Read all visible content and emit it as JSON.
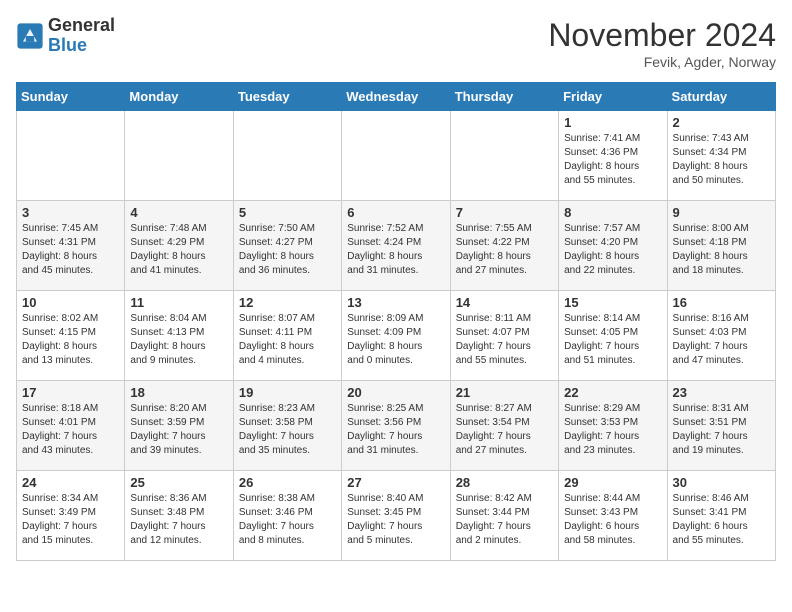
{
  "logo": {
    "general": "General",
    "blue": "Blue"
  },
  "title": "November 2024",
  "subtitle": "Fevik, Agder, Norway",
  "weekdays": [
    "Sunday",
    "Monday",
    "Tuesday",
    "Wednesday",
    "Thursday",
    "Friday",
    "Saturday"
  ],
  "weeks": [
    [
      {
        "day": "",
        "info": ""
      },
      {
        "day": "",
        "info": ""
      },
      {
        "day": "",
        "info": ""
      },
      {
        "day": "",
        "info": ""
      },
      {
        "day": "",
        "info": ""
      },
      {
        "day": "1",
        "info": "Sunrise: 7:41 AM\nSunset: 4:36 PM\nDaylight: 8 hours\nand 55 minutes."
      },
      {
        "day": "2",
        "info": "Sunrise: 7:43 AM\nSunset: 4:34 PM\nDaylight: 8 hours\nand 50 minutes."
      }
    ],
    [
      {
        "day": "3",
        "info": "Sunrise: 7:45 AM\nSunset: 4:31 PM\nDaylight: 8 hours\nand 45 minutes."
      },
      {
        "day": "4",
        "info": "Sunrise: 7:48 AM\nSunset: 4:29 PM\nDaylight: 8 hours\nand 41 minutes."
      },
      {
        "day": "5",
        "info": "Sunrise: 7:50 AM\nSunset: 4:27 PM\nDaylight: 8 hours\nand 36 minutes."
      },
      {
        "day": "6",
        "info": "Sunrise: 7:52 AM\nSunset: 4:24 PM\nDaylight: 8 hours\nand 31 minutes."
      },
      {
        "day": "7",
        "info": "Sunrise: 7:55 AM\nSunset: 4:22 PM\nDaylight: 8 hours\nand 27 minutes."
      },
      {
        "day": "8",
        "info": "Sunrise: 7:57 AM\nSunset: 4:20 PM\nDaylight: 8 hours\nand 22 minutes."
      },
      {
        "day": "9",
        "info": "Sunrise: 8:00 AM\nSunset: 4:18 PM\nDaylight: 8 hours\nand 18 minutes."
      }
    ],
    [
      {
        "day": "10",
        "info": "Sunrise: 8:02 AM\nSunset: 4:15 PM\nDaylight: 8 hours\nand 13 minutes."
      },
      {
        "day": "11",
        "info": "Sunrise: 8:04 AM\nSunset: 4:13 PM\nDaylight: 8 hours\nand 9 minutes."
      },
      {
        "day": "12",
        "info": "Sunrise: 8:07 AM\nSunset: 4:11 PM\nDaylight: 8 hours\nand 4 minutes."
      },
      {
        "day": "13",
        "info": "Sunrise: 8:09 AM\nSunset: 4:09 PM\nDaylight: 8 hours\nand 0 minutes."
      },
      {
        "day": "14",
        "info": "Sunrise: 8:11 AM\nSunset: 4:07 PM\nDaylight: 7 hours\nand 55 minutes."
      },
      {
        "day": "15",
        "info": "Sunrise: 8:14 AM\nSunset: 4:05 PM\nDaylight: 7 hours\nand 51 minutes."
      },
      {
        "day": "16",
        "info": "Sunrise: 8:16 AM\nSunset: 4:03 PM\nDaylight: 7 hours\nand 47 minutes."
      }
    ],
    [
      {
        "day": "17",
        "info": "Sunrise: 8:18 AM\nSunset: 4:01 PM\nDaylight: 7 hours\nand 43 minutes."
      },
      {
        "day": "18",
        "info": "Sunrise: 8:20 AM\nSunset: 3:59 PM\nDaylight: 7 hours\nand 39 minutes."
      },
      {
        "day": "19",
        "info": "Sunrise: 8:23 AM\nSunset: 3:58 PM\nDaylight: 7 hours\nand 35 minutes."
      },
      {
        "day": "20",
        "info": "Sunrise: 8:25 AM\nSunset: 3:56 PM\nDaylight: 7 hours\nand 31 minutes."
      },
      {
        "day": "21",
        "info": "Sunrise: 8:27 AM\nSunset: 3:54 PM\nDaylight: 7 hours\nand 27 minutes."
      },
      {
        "day": "22",
        "info": "Sunrise: 8:29 AM\nSunset: 3:53 PM\nDaylight: 7 hours\nand 23 minutes."
      },
      {
        "day": "23",
        "info": "Sunrise: 8:31 AM\nSunset: 3:51 PM\nDaylight: 7 hours\nand 19 minutes."
      }
    ],
    [
      {
        "day": "24",
        "info": "Sunrise: 8:34 AM\nSunset: 3:49 PM\nDaylight: 7 hours\nand 15 minutes."
      },
      {
        "day": "25",
        "info": "Sunrise: 8:36 AM\nSunset: 3:48 PM\nDaylight: 7 hours\nand 12 minutes."
      },
      {
        "day": "26",
        "info": "Sunrise: 8:38 AM\nSunset: 3:46 PM\nDaylight: 7 hours\nand 8 minutes."
      },
      {
        "day": "27",
        "info": "Sunrise: 8:40 AM\nSunset: 3:45 PM\nDaylight: 7 hours\nand 5 minutes."
      },
      {
        "day": "28",
        "info": "Sunrise: 8:42 AM\nSunset: 3:44 PM\nDaylight: 7 hours\nand 2 minutes."
      },
      {
        "day": "29",
        "info": "Sunrise: 8:44 AM\nSunset: 3:43 PM\nDaylight: 6 hours\nand 58 minutes."
      },
      {
        "day": "30",
        "info": "Sunrise: 8:46 AM\nSunset: 3:41 PM\nDaylight: 6 hours\nand 55 minutes."
      }
    ]
  ]
}
